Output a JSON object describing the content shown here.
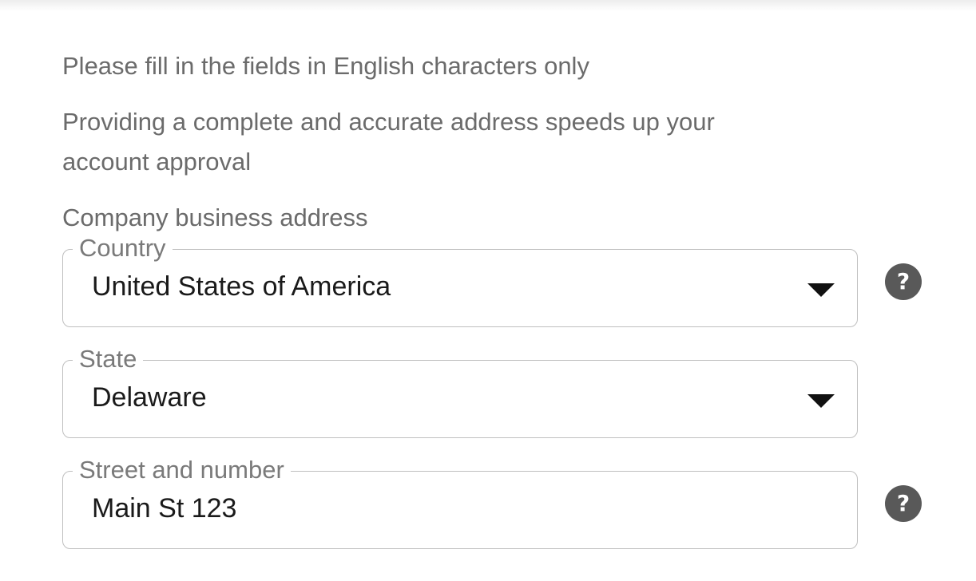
{
  "form": {
    "notes": {
      "english_only": "Please fill in the fields in English characters only",
      "complete_address": "Providing a complete and accurate address speeds up your account approval"
    },
    "section_title": "Company business address",
    "fields": {
      "country": {
        "label": "Country",
        "value": "United States of America",
        "type": "select"
      },
      "state": {
        "label": "State",
        "value": "Delaware",
        "type": "select"
      },
      "street": {
        "label": "Street and number",
        "value": "Main St 123",
        "type": "text"
      }
    },
    "help_glyph": "?"
  },
  "icons": {
    "dropdown": "caret-down-icon",
    "help": "question-circle-icon"
  },
  "colors": {
    "text_muted": "#6b6b6b",
    "text_value": "#1a1a1a",
    "border": "#bfbfbf",
    "help_bg": "#595959"
  }
}
